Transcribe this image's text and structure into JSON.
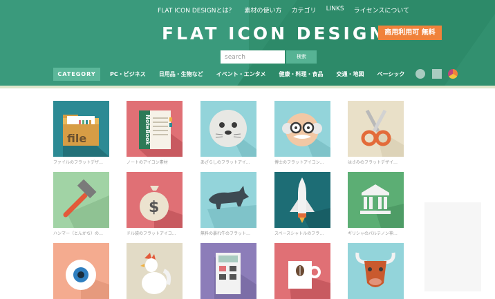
{
  "topnav": [
    "FLAT ICON DESIGNとは？",
    "素材の使い方",
    "カテゴリ",
    "LINKS",
    "ライセンスについて"
  ],
  "brand": "FLAT ICON DESIGN",
  "badge": "商用利用可 無料",
  "search": {
    "placeholder": "search",
    "button": "検索"
  },
  "catnav": {
    "button": "CATEGORY",
    "links": [
      "PC・ビジネス",
      "日用品・生物など",
      "イベント・エンタメ",
      "健康・料理・食品",
      "交通・地図",
      "ベーシック"
    ]
  },
  "icons": [
    {
      "caption": "ファイルのフラットデザ…",
      "icon": "folder-file-icon",
      "bg": "#2c8a94"
    },
    {
      "caption": "ノートのアイコン素材",
      "icon": "notebook-icon",
      "bg": "#e07075"
    },
    {
      "caption": "あざらしのフラットアイ…",
      "icon": "seal-icon",
      "bg": "#93d4da"
    },
    {
      "caption": "博士のフラットアイコン…",
      "icon": "professor-icon",
      "bg": "#93d4da"
    },
    {
      "caption": "はさみのフラットデザイ…",
      "icon": "scissors-icon",
      "bg": "#e9e0c8"
    },
    {
      "caption": "ハンマー（とんかち）の…",
      "icon": "hammer-icon",
      "bg": "#a1d3a5"
    },
    {
      "caption": "ドル袋のフラットアイコ…",
      "icon": "money-bag-icon",
      "bg": "#e07075"
    },
    {
      "caption": "無料の暴れ牛のフラット…",
      "icon": "bull-icon",
      "bg": "#93d4da"
    },
    {
      "caption": "スペースシャトルのフラ…",
      "icon": "space-shuttle-icon",
      "bg": "#1d6d75"
    },
    {
      "caption": "ギリシャのパルテノン神…",
      "icon": "greek-temple-icon",
      "bg": "#5cae74"
    },
    {
      "caption": "",
      "icon": "eyeball-icon",
      "bg": "#f4ab8f"
    },
    {
      "caption": "",
      "icon": "rooster-icon",
      "bg": "#e2dbc6"
    },
    {
      "caption": "",
      "icon": "calculator-icon",
      "bg": "#8c7db9"
    },
    {
      "caption": "",
      "icon": "coffee-mug-icon",
      "bg": "#e07075"
    },
    {
      "caption": "",
      "icon": "bull-head-icon",
      "bg": "#93d4da"
    }
  ]
}
